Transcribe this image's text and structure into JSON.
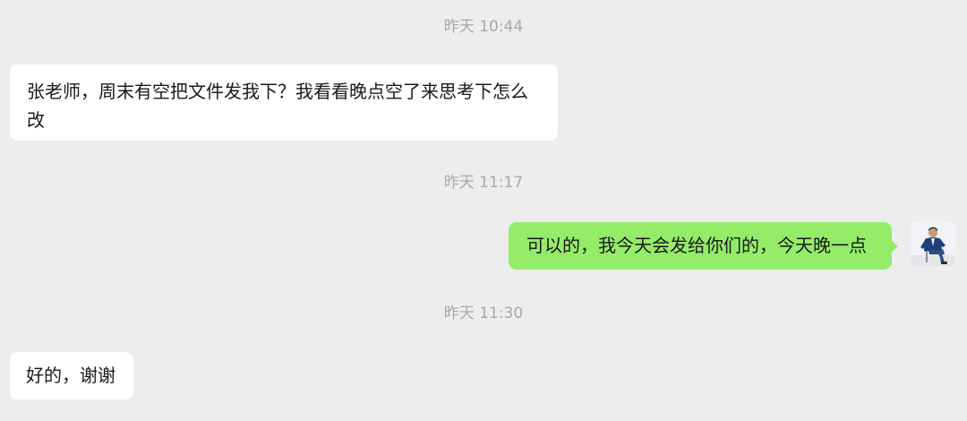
{
  "chat": {
    "messages": [
      {
        "type": "timestamp",
        "text": "昨天 10:44"
      },
      {
        "type": "received",
        "text": "张老师，周末有空把文件发我下？我看看晚点空了来思考下怎么改"
      },
      {
        "type": "timestamp",
        "text": "昨天 11:17"
      },
      {
        "type": "sent",
        "text": "可以的，我今天会发给你们的，今天晚一点",
        "avatar_icon": "user-avatar-icon"
      },
      {
        "type": "timestamp",
        "text": "昨天 11:30"
      },
      {
        "type": "received",
        "text": "好的，谢谢"
      }
    ]
  },
  "colors": {
    "background": "#ededed",
    "received_bubble": "#ffffff",
    "sent_bubble": "#95ec69",
    "timestamp_text": "#a8a8a8",
    "message_text": "#191919"
  }
}
